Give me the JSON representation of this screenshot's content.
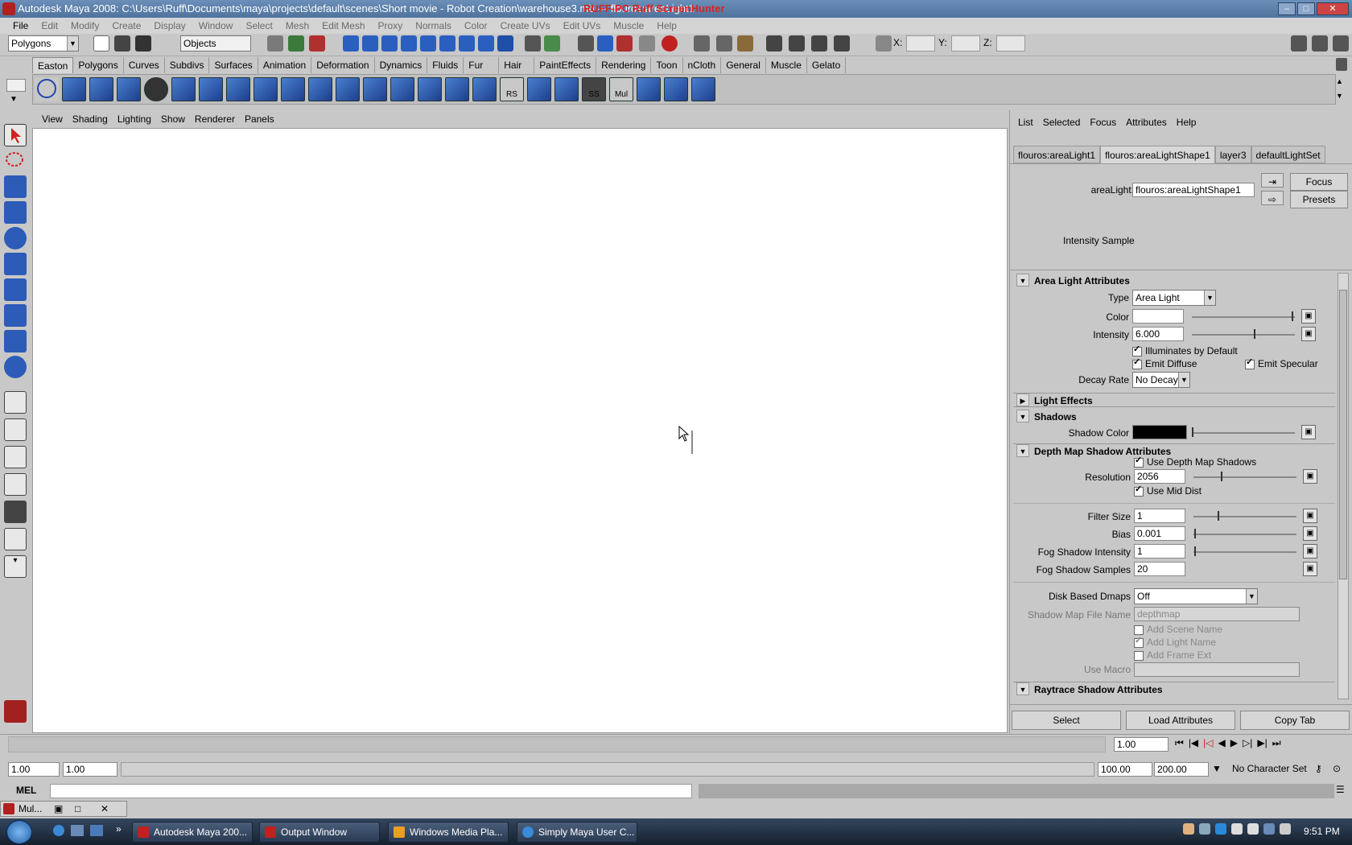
{
  "window": {
    "title": "Autodesk Maya 2008: C:\\Users\\Ruff\\Documents\\maya\\projects\\default\\scenes\\Short movie - Robot Creation\\warehouse3.mb  ---   flouros:areaLight1",
    "overlay_text": "RUFF-PC  Ruff  ScreenHunter"
  },
  "menubar": [
    {
      "label": "File"
    },
    {
      "label": "Edit"
    },
    {
      "label": "Modify"
    },
    {
      "label": "Create"
    },
    {
      "label": "Display"
    },
    {
      "label": "Window"
    },
    {
      "label": "Select"
    },
    {
      "label": "Mesh"
    },
    {
      "label": "Edit Mesh"
    },
    {
      "label": "Proxy"
    },
    {
      "label": "Normals"
    },
    {
      "label": "Color"
    },
    {
      "label": "Create UVs"
    },
    {
      "label": "Edit UVs"
    },
    {
      "label": "Muscle"
    },
    {
      "label": "Help"
    }
  ],
  "statusline": {
    "menuset": "Polygons",
    "select_mode": "Objects",
    "x_label": "X:",
    "y_label": "Y:",
    "z_label": "Z:"
  },
  "shelf_tabs": [
    "Easton",
    "Polygons",
    "Curves",
    "Subdivs",
    "Surfaces",
    "Animation",
    "Deformation",
    "Dynamics",
    "Fluids",
    "Fur",
    "Hair",
    "PaintEffects",
    "Rendering",
    "Toon",
    "nCloth",
    "General",
    "Muscle",
    "Gelato"
  ],
  "shelf_active": "Easton",
  "shelf_button_labels": {
    "rs": "RS",
    "ss": "SS",
    "mul": "Mul"
  },
  "panel_menu": [
    "View",
    "Shading",
    "Lighting",
    "Show",
    "Renderer",
    "Panels"
  ],
  "attribute_editor": {
    "menu": [
      "List",
      "Selected",
      "Focus",
      "Attributes",
      "Help"
    ],
    "tabs": [
      "flouros:areaLight1",
      "flouros:areaLightShape1",
      "layer3",
      "defaultLightSet"
    ],
    "active_tab": "flouros:areaLightShape1",
    "node_label": "areaLight:",
    "node_value": "flouros:areaLightShape1",
    "focus_label": "Focus",
    "presets_label": "Presets",
    "intensity_sample": "Intensity Sample",
    "area_light": {
      "section": "Area Light Attributes",
      "type_label": "Type",
      "type_value": "Area Light",
      "color_label": "Color",
      "intensity_label": "Intensity",
      "intensity_value": "6.000",
      "intensity_level": 0.6,
      "illuminates_label": "Illuminates by Default",
      "emit_diffuse_label": "Emit Diffuse",
      "emit_specular_label": "Emit Specular",
      "decay_label": "Decay Rate",
      "decay_value": "No Decay"
    },
    "light_effects_section": "Light Effects",
    "shadows": {
      "section": "Shadows",
      "shadow_color_label": "Shadow Color"
    },
    "depth_map": {
      "section": "Depth Map Shadow Attributes",
      "use_depth_label": "Use Depth Map Shadows",
      "resolution_label": "Resolution",
      "resolution_value": "2056",
      "use_mid_label": "Use Mid Dist",
      "filter_label": "Filter Size",
      "filter_value": "1",
      "bias_label": "Bias",
      "bias_value": "0.001",
      "fog_int_label": "Fog Shadow Intensity",
      "fog_int_value": "1",
      "fog_samp_label": "Fog Shadow Samples",
      "fog_samp_value": "20",
      "disk_label": "Disk Based Dmaps",
      "disk_value": "Off",
      "file_label": "Shadow Map File Name",
      "file_value": "depthmap",
      "add_scene_label": "Add Scene Name",
      "add_light_label": "Add Light Name",
      "add_frame_label": "Add Frame Ext",
      "macro_label": "Use Macro"
    },
    "raytrace_section": "Raytrace Shadow Attributes",
    "bottom_buttons": {
      "select": "Select",
      "load": "Load Attributes",
      "copy": "Copy Tab"
    }
  },
  "timeslider": {
    "current_frame": "1.00"
  },
  "range": {
    "start": "1.00",
    "inner_start": "1.00",
    "inner_end": "100.00",
    "end": "200.00",
    "character_set": "No Character Set"
  },
  "cmdline": {
    "label": "MEL"
  },
  "mini_window": {
    "label": "Mul..."
  },
  "taskbar": {
    "items": [
      "Autodesk Maya 200...",
      "Output Window",
      "Windows Media Pla...",
      "Simply Maya User C..."
    ],
    "clock": "9:51 PM"
  },
  "colors": {
    "viewport_bg": "#ffffff",
    "shadow_color": "#000000",
    "light_color": "#ffffff"
  }
}
